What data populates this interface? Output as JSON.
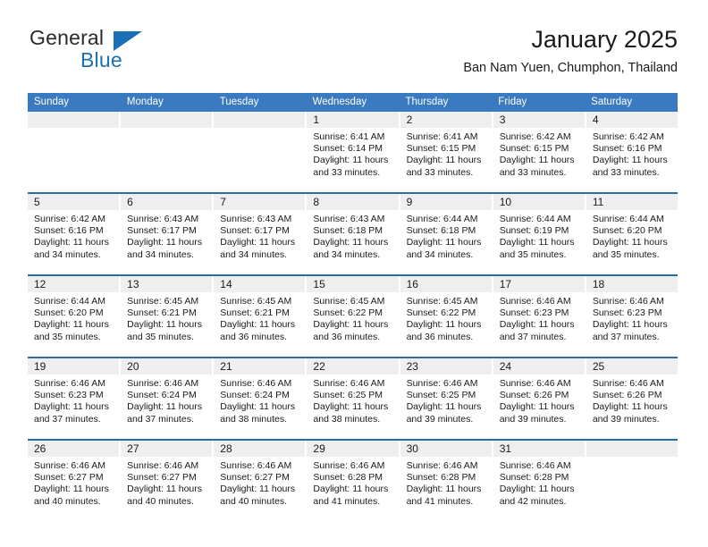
{
  "brand": {
    "name_top": "General",
    "name_bottom": "Blue",
    "accent_color": "#1a6fb5",
    "logo_icon": "triangle-icon"
  },
  "header": {
    "title": "January 2025",
    "subtitle": "Ban Nam Yuen, Chumphon, Thailand"
  },
  "theme": {
    "header_blue": "#3a7ac0",
    "row_rule_blue": "#2c6cab",
    "day_band_gray": "#efefef"
  },
  "weekdays": [
    "Sunday",
    "Monday",
    "Tuesday",
    "Wednesday",
    "Thursday",
    "Friday",
    "Saturday"
  ],
  "labels": {
    "sunrise_prefix": "Sunrise:",
    "sunset_prefix": "Sunset:",
    "daylight_prefix": "Daylight:"
  },
  "weeks": [
    [
      {
        "empty": true
      },
      {
        "empty": true
      },
      {
        "empty": true
      },
      {
        "day": "1",
        "sunrise": "Sunrise: 6:41 AM",
        "sunset": "Sunset: 6:14 PM",
        "daylight1": "Daylight: 11 hours",
        "daylight2": "and 33 minutes."
      },
      {
        "day": "2",
        "sunrise": "Sunrise: 6:41 AM",
        "sunset": "Sunset: 6:15 PM",
        "daylight1": "Daylight: 11 hours",
        "daylight2": "and 33 minutes."
      },
      {
        "day": "3",
        "sunrise": "Sunrise: 6:42 AM",
        "sunset": "Sunset: 6:15 PM",
        "daylight1": "Daylight: 11 hours",
        "daylight2": "and 33 minutes."
      },
      {
        "day": "4",
        "sunrise": "Sunrise: 6:42 AM",
        "sunset": "Sunset: 6:16 PM",
        "daylight1": "Daylight: 11 hours",
        "daylight2": "and 33 minutes."
      }
    ],
    [
      {
        "day": "5",
        "sunrise": "Sunrise: 6:42 AM",
        "sunset": "Sunset: 6:16 PM",
        "daylight1": "Daylight: 11 hours",
        "daylight2": "and 34 minutes."
      },
      {
        "day": "6",
        "sunrise": "Sunrise: 6:43 AM",
        "sunset": "Sunset: 6:17 PM",
        "daylight1": "Daylight: 11 hours",
        "daylight2": "and 34 minutes."
      },
      {
        "day": "7",
        "sunrise": "Sunrise: 6:43 AM",
        "sunset": "Sunset: 6:17 PM",
        "daylight1": "Daylight: 11 hours",
        "daylight2": "and 34 minutes."
      },
      {
        "day": "8",
        "sunrise": "Sunrise: 6:43 AM",
        "sunset": "Sunset: 6:18 PM",
        "daylight1": "Daylight: 11 hours",
        "daylight2": "and 34 minutes."
      },
      {
        "day": "9",
        "sunrise": "Sunrise: 6:44 AM",
        "sunset": "Sunset: 6:18 PM",
        "daylight1": "Daylight: 11 hours",
        "daylight2": "and 34 minutes."
      },
      {
        "day": "10",
        "sunrise": "Sunrise: 6:44 AM",
        "sunset": "Sunset: 6:19 PM",
        "daylight1": "Daylight: 11 hours",
        "daylight2": "and 35 minutes."
      },
      {
        "day": "11",
        "sunrise": "Sunrise: 6:44 AM",
        "sunset": "Sunset: 6:20 PM",
        "daylight1": "Daylight: 11 hours",
        "daylight2": "and 35 minutes."
      }
    ],
    [
      {
        "day": "12",
        "sunrise": "Sunrise: 6:44 AM",
        "sunset": "Sunset: 6:20 PM",
        "daylight1": "Daylight: 11 hours",
        "daylight2": "and 35 minutes."
      },
      {
        "day": "13",
        "sunrise": "Sunrise: 6:45 AM",
        "sunset": "Sunset: 6:21 PM",
        "daylight1": "Daylight: 11 hours",
        "daylight2": "and 35 minutes."
      },
      {
        "day": "14",
        "sunrise": "Sunrise: 6:45 AM",
        "sunset": "Sunset: 6:21 PM",
        "daylight1": "Daylight: 11 hours",
        "daylight2": "and 36 minutes."
      },
      {
        "day": "15",
        "sunrise": "Sunrise: 6:45 AM",
        "sunset": "Sunset: 6:22 PM",
        "daylight1": "Daylight: 11 hours",
        "daylight2": "and 36 minutes."
      },
      {
        "day": "16",
        "sunrise": "Sunrise: 6:45 AM",
        "sunset": "Sunset: 6:22 PM",
        "daylight1": "Daylight: 11 hours",
        "daylight2": "and 36 minutes."
      },
      {
        "day": "17",
        "sunrise": "Sunrise: 6:46 AM",
        "sunset": "Sunset: 6:23 PM",
        "daylight1": "Daylight: 11 hours",
        "daylight2": "and 37 minutes."
      },
      {
        "day": "18",
        "sunrise": "Sunrise: 6:46 AM",
        "sunset": "Sunset: 6:23 PM",
        "daylight1": "Daylight: 11 hours",
        "daylight2": "and 37 minutes."
      }
    ],
    [
      {
        "day": "19",
        "sunrise": "Sunrise: 6:46 AM",
        "sunset": "Sunset: 6:23 PM",
        "daylight1": "Daylight: 11 hours",
        "daylight2": "and 37 minutes."
      },
      {
        "day": "20",
        "sunrise": "Sunrise: 6:46 AM",
        "sunset": "Sunset: 6:24 PM",
        "daylight1": "Daylight: 11 hours",
        "daylight2": "and 37 minutes."
      },
      {
        "day": "21",
        "sunrise": "Sunrise: 6:46 AM",
        "sunset": "Sunset: 6:24 PM",
        "daylight1": "Daylight: 11 hours",
        "daylight2": "and 38 minutes."
      },
      {
        "day": "22",
        "sunrise": "Sunrise: 6:46 AM",
        "sunset": "Sunset: 6:25 PM",
        "daylight1": "Daylight: 11 hours",
        "daylight2": "and 38 minutes."
      },
      {
        "day": "23",
        "sunrise": "Sunrise: 6:46 AM",
        "sunset": "Sunset: 6:25 PM",
        "daylight1": "Daylight: 11 hours",
        "daylight2": "and 39 minutes."
      },
      {
        "day": "24",
        "sunrise": "Sunrise: 6:46 AM",
        "sunset": "Sunset: 6:26 PM",
        "daylight1": "Daylight: 11 hours",
        "daylight2": "and 39 minutes."
      },
      {
        "day": "25",
        "sunrise": "Sunrise: 6:46 AM",
        "sunset": "Sunset: 6:26 PM",
        "daylight1": "Daylight: 11 hours",
        "daylight2": "and 39 minutes."
      }
    ],
    [
      {
        "day": "26",
        "sunrise": "Sunrise: 6:46 AM",
        "sunset": "Sunset: 6:27 PM",
        "daylight1": "Daylight: 11 hours",
        "daylight2": "and 40 minutes."
      },
      {
        "day": "27",
        "sunrise": "Sunrise: 6:46 AM",
        "sunset": "Sunset: 6:27 PM",
        "daylight1": "Daylight: 11 hours",
        "daylight2": "and 40 minutes."
      },
      {
        "day": "28",
        "sunrise": "Sunrise: 6:46 AM",
        "sunset": "Sunset: 6:27 PM",
        "daylight1": "Daylight: 11 hours",
        "daylight2": "and 40 minutes."
      },
      {
        "day": "29",
        "sunrise": "Sunrise: 6:46 AM",
        "sunset": "Sunset: 6:28 PM",
        "daylight1": "Daylight: 11 hours",
        "daylight2": "and 41 minutes."
      },
      {
        "day": "30",
        "sunrise": "Sunrise: 6:46 AM",
        "sunset": "Sunset: 6:28 PM",
        "daylight1": "Daylight: 11 hours",
        "daylight2": "and 41 minutes."
      },
      {
        "day": "31",
        "sunrise": "Sunrise: 6:46 AM",
        "sunset": "Sunset: 6:28 PM",
        "daylight1": "Daylight: 11 hours",
        "daylight2": "and 42 minutes."
      },
      {
        "empty": true
      }
    ]
  ]
}
